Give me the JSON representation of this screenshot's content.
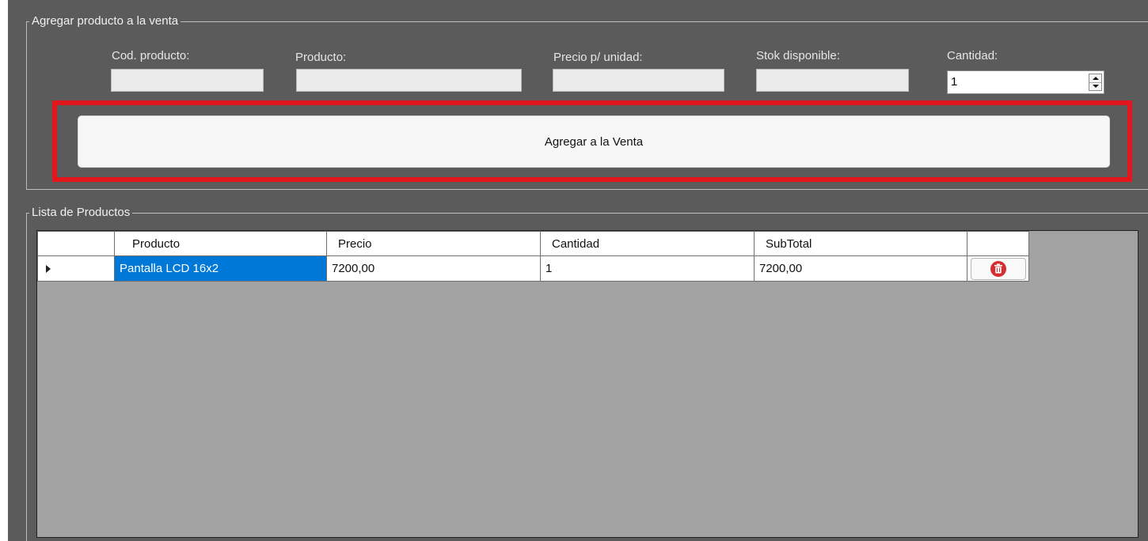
{
  "add_group": {
    "legend": "Agregar producto a la venta",
    "labels": {
      "code": "Cod. producto:",
      "product": "Producto:",
      "price": "Precio p/ unidad:",
      "stock": "Stok disponible:",
      "quantity": "Cantidad:"
    },
    "values": {
      "code": "",
      "product": "",
      "price": "",
      "stock": "",
      "quantity": "1"
    },
    "add_button_label": "Agregar a la Venta"
  },
  "list_group": {
    "legend": "Lista de Productos",
    "columns": [
      "Producto",
      "Precio",
      "Cantidad",
      "SubTotal"
    ],
    "rows": [
      {
        "producto": "Pantalla LCD 16x2",
        "precio": "7200,00",
        "cantidad": "1",
        "subtotal": "7200,00"
      }
    ]
  },
  "colors": {
    "panel_bg": "#5b5b5b",
    "highlight": "#e3161c",
    "selection": "#0078d7",
    "grid_bg": "#a2a2a2",
    "delete_icon": "#d42e2e"
  },
  "icons": {
    "row_indicator": "row-arrow-icon",
    "delete": "trash-icon"
  }
}
